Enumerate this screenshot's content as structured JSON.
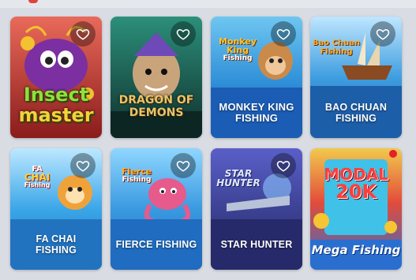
{
  "games": [
    {
      "title": "Insect master",
      "logo_lines": [
        "Insect",
        "master"
      ],
      "band_label": "",
      "theme": "#c0392b"
    },
    {
      "title": "Dragon of Demons",
      "logo_lines": [
        "DRAGON OF",
        "DEMONS"
      ],
      "band_label": "",
      "theme": "#1f5a4a"
    },
    {
      "title": "Monkey King Fishing",
      "logo_lines": [
        "Monkey",
        "King",
        "Fishing"
      ],
      "band_label": "MONKEY KING  FISHING",
      "theme": "#1f6fbf"
    },
    {
      "title": "Bao Chuan Fishing",
      "logo_lines": [
        "Bao Chuan",
        "Fishing"
      ],
      "band_label": "BAO CHUAN FISHING",
      "theme": "#2b86c9"
    },
    {
      "title": "Fa Chai Fishing",
      "logo_lines": [
        "FA",
        "CHAI",
        "Fishing"
      ],
      "band_label": "FA CHAI FISHING",
      "theme": "#2d8fd6"
    },
    {
      "title": "Fierce Fishing",
      "logo_lines": [
        "Fierce",
        "Fishing"
      ],
      "band_label": "FIERCE FISHING",
      "theme": "#2a8ed8"
    },
    {
      "title": "Star Hunter",
      "logo_lines": [
        "STAR",
        "HUNTER"
      ],
      "band_label": "STAR HUNTER",
      "theme": "#3a3f8f"
    },
    {
      "title": "Mega Fishing",
      "logo_lines": [
        "MODAL",
        "20K",
        "Mega Fishing"
      ],
      "band_label": "",
      "theme": "#2a6fd0"
    }
  ],
  "icons": {
    "favorite": "heart-outline-icon"
  }
}
